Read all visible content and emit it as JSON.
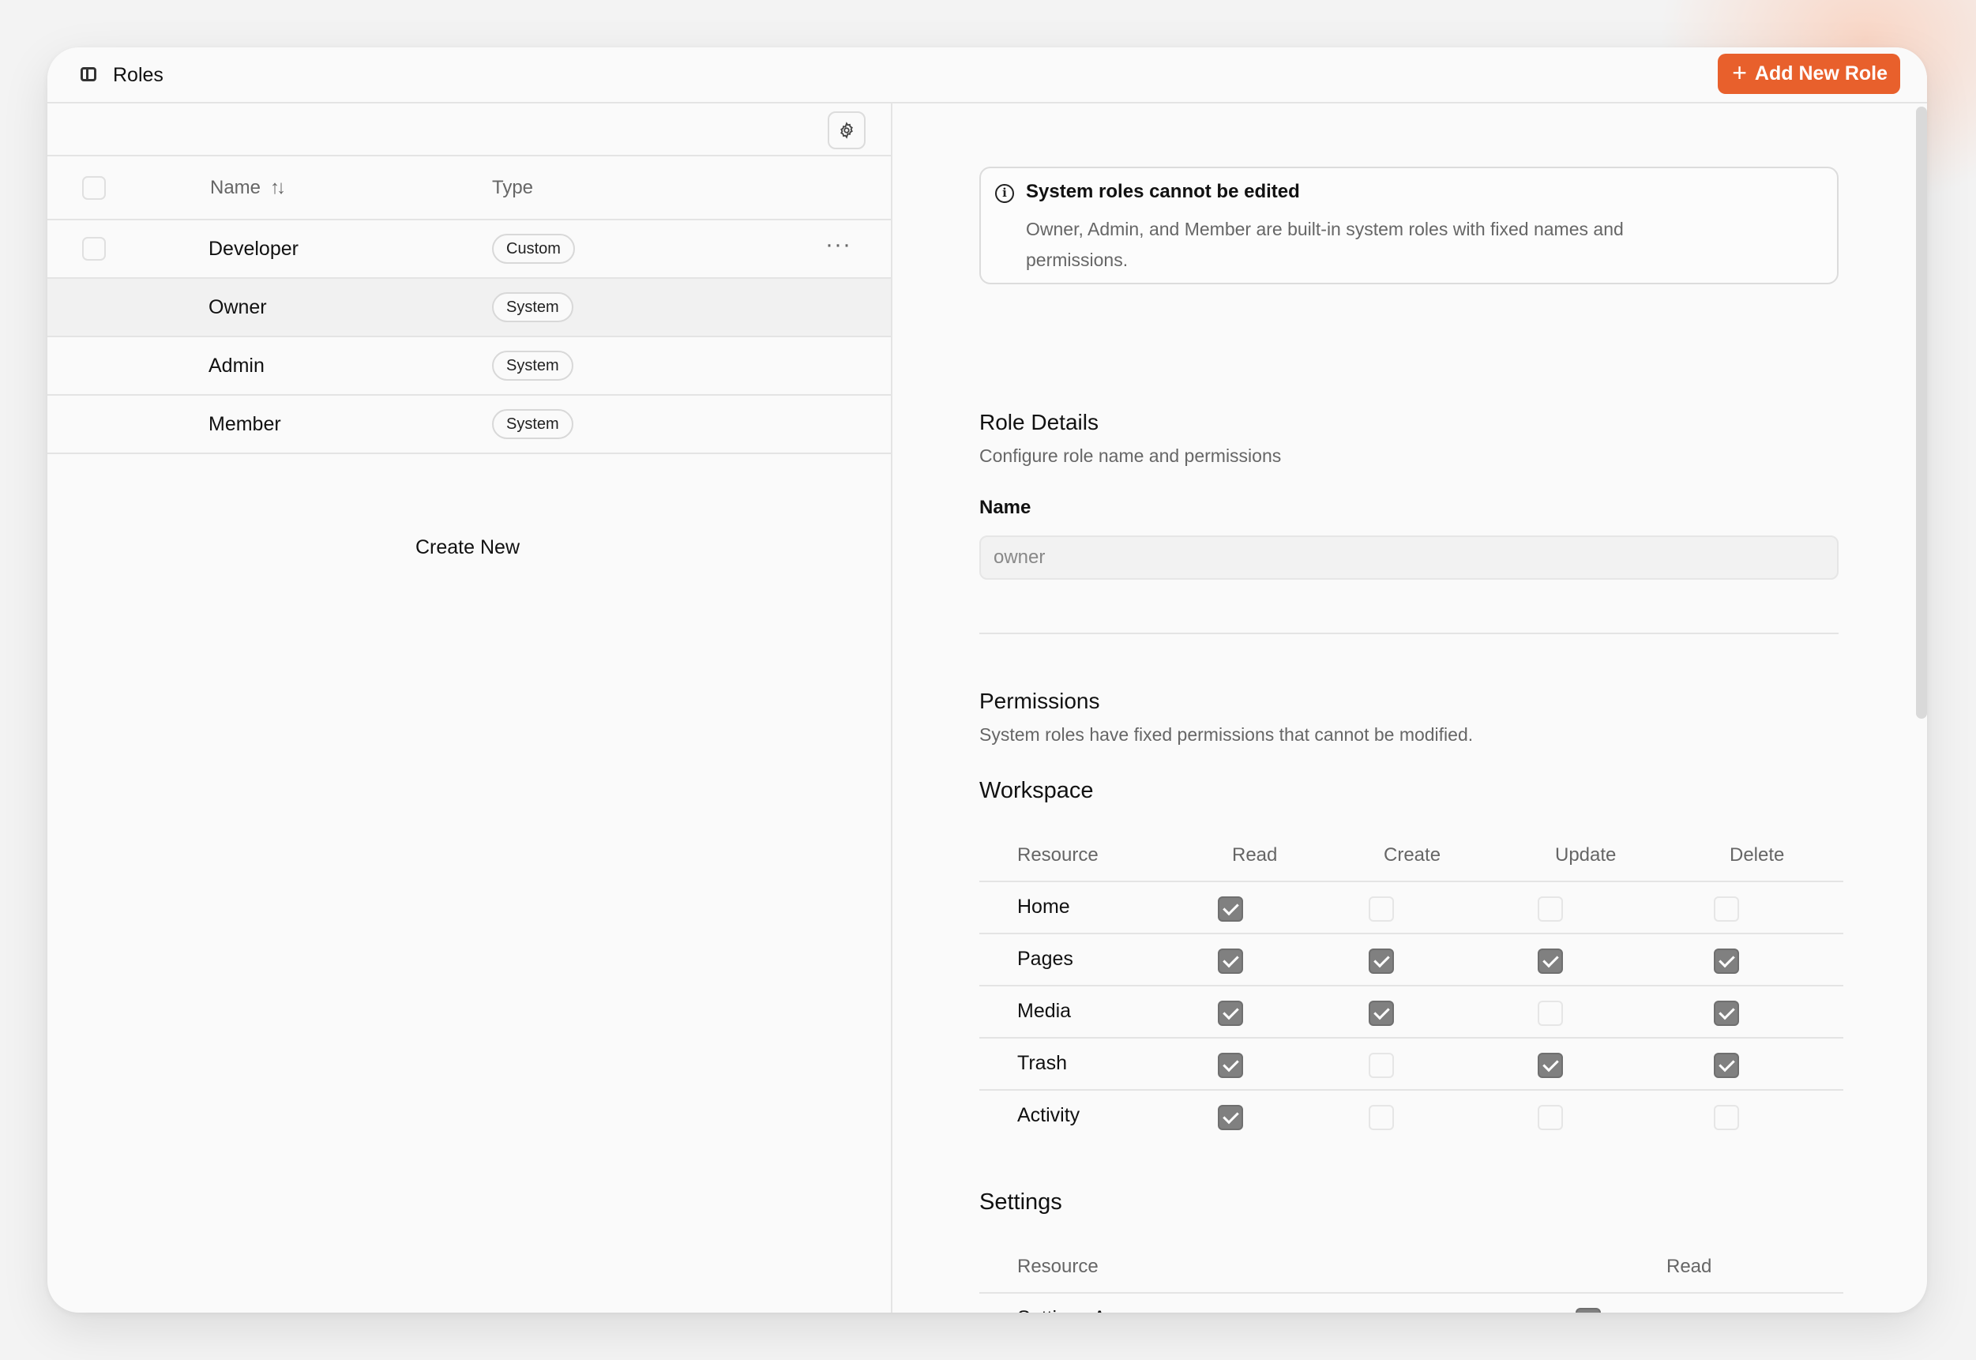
{
  "header": {
    "title": "Roles",
    "add_button_label": "Add New Role",
    "add_button_icon": "plus-icon",
    "accent_color": "#e8602c"
  },
  "roles_table": {
    "columns": {
      "name": "Name",
      "type": "Type"
    },
    "rows": [
      {
        "name": "Developer",
        "type": "Custom",
        "has_actions": true
      },
      {
        "name": "Owner",
        "type": "System",
        "selected": true
      },
      {
        "name": "Admin",
        "type": "System"
      },
      {
        "name": "Member",
        "type": "System"
      }
    ],
    "row_actions_label": "···",
    "create_new_label": "Create New"
  },
  "detail": {
    "alert": {
      "title": "System roles cannot be edited",
      "description": "Owner, Admin, and Member are built-in system roles with fixed names and permissions."
    },
    "role_details": {
      "title": "Role Details",
      "subtitle": "Configure role name and permissions",
      "name_label": "Name",
      "name_value": "owner"
    },
    "permissions": {
      "title": "Permissions",
      "subtitle": "System roles have fixed permissions that cannot be modified.",
      "workspace": {
        "title": "Workspace",
        "columns": [
          "Resource",
          "Read",
          "Create",
          "Update",
          "Delete"
        ],
        "rows": [
          {
            "label": "Home",
            "values": [
              true,
              false,
              false,
              false
            ]
          },
          {
            "label": "Pages",
            "values": [
              true,
              true,
              true,
              true
            ]
          },
          {
            "label": "Media",
            "values": [
              true,
              true,
              false,
              true
            ]
          },
          {
            "label": "Trash",
            "values": [
              true,
              false,
              true,
              true
            ]
          },
          {
            "label": "Activity",
            "values": [
              true,
              false,
              false,
              false
            ]
          }
        ]
      },
      "settings": {
        "title": "Settings",
        "columns": [
          "Resource",
          "Read"
        ],
        "rows": [
          {
            "label": "Settings Access",
            "values": [
              true
            ]
          }
        ]
      }
    }
  }
}
